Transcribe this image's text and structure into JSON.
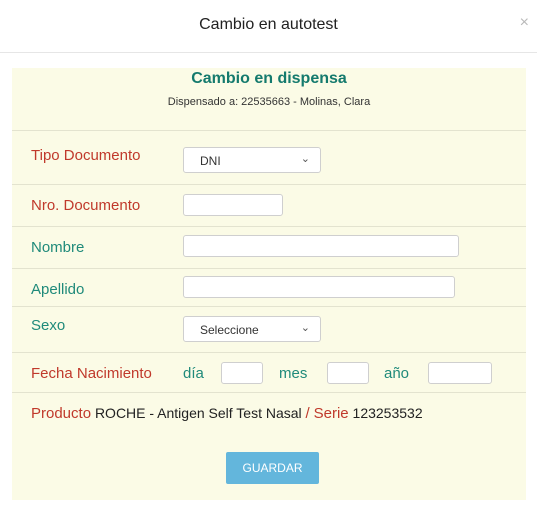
{
  "modal": {
    "title": "Cambio en autotest",
    "close_glyph": "×"
  },
  "panel": {
    "title": "Cambio en dispensa",
    "subtitle": "Dispensado a: 22535663 - Molinas, Clara"
  },
  "form": {
    "tipo_documento": {
      "label": "Tipo Documento",
      "value": "DNI"
    },
    "nro_documento": {
      "label": "Nro. Documento",
      "value": ""
    },
    "nombre": {
      "label": "Nombre",
      "value": ""
    },
    "apellido": {
      "label": "Apellido",
      "value": ""
    },
    "sexo": {
      "label": "Sexo",
      "value": "Seleccione"
    },
    "fecha_nacimiento": {
      "label": "Fecha Nacimiento",
      "dia_label": "día",
      "mes_label": "mes",
      "anio_label": "año"
    },
    "producto": {
      "label": "Producto",
      "value": "ROCHE - Antigen Self Test Nasal",
      "separator": "/",
      "serie_label": "Serie",
      "serie_value": "123253532"
    },
    "save_label": "GUARDAR"
  },
  "icons": {
    "dropdown": "chevron-down-icon",
    "close": "close-icon"
  },
  "colors": {
    "label_red": "#c0392b",
    "label_teal": "#1f8a7a",
    "panel_bg": "#fbfbe6",
    "button": "#63b6dc"
  }
}
